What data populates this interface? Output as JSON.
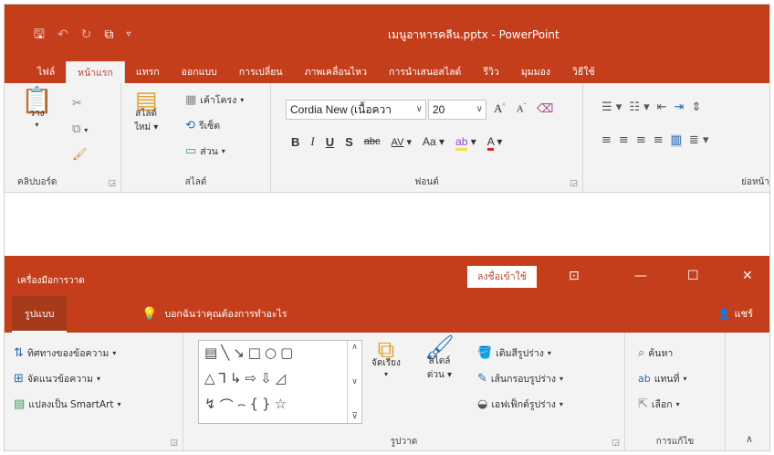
{
  "window1": {
    "qat": {
      "save_icon": "save-icon",
      "undo_icon": "undo-icon",
      "redo_icon": "redo-icon",
      "present_icon": "present-icon",
      "customize_icon": "chevron-down-icon"
    },
    "title": "เมนูอาหารคลีน.pptx  -  PowerPoint",
    "tabs": [
      "ไฟล์",
      "หน้าแรก",
      "แทรก",
      "ออกแบบ",
      "การเปลี่ยน",
      "ภาพเคลื่อนไหว",
      "การนำเสนอสไลด์",
      "รีวิว",
      "มุมมอง",
      "วิธีใช้"
    ],
    "active_tab": "หน้าแรก",
    "clipboard": {
      "paste": "วาง",
      "label": "คลิปบอร์ด"
    },
    "slides": {
      "new_slide": "สไลด์",
      "new_slide_2": "ใหม่",
      "layout": "เค้าโครง",
      "reset": "รีเซ็ต",
      "section": "ส่วน",
      "label": "สไลด์"
    },
    "font": {
      "name": "Cordia New (เนื้อควา",
      "size": "20",
      "bold": "B",
      "italic": "I",
      "underline": "U",
      "shadow": "S",
      "strike": "abc",
      "spacing": "AV",
      "case": "Aa",
      "label": "ฟอนต์"
    },
    "paragraph": {
      "label": "ย่อหน้า"
    }
  },
  "window2": {
    "app_title": "เครื่องมือการวาด",
    "signin": "ลงชื่อเข้าใช้",
    "active_tab": "รูปแบบ",
    "tell_me": "บอกฉันว่าคุณต้องการทำอะไร",
    "share": "แชร์",
    "text_group": {
      "direction": "ทิศทางของข้อความ",
      "align": "จัดแนวข้อความ",
      "smartart": "แปลงเป็น SmartArt"
    },
    "arrange": "จัดเรียง",
    "quick_styles": "สไตล์",
    "quick_styles_2": "ด่วน",
    "shape_fill": "เติมสีรูปร่าง",
    "shape_outline": "เส้นกรอบรูปร่าง",
    "shape_effects": "เอฟเฟ็กต์รูปร่าง",
    "shapes_label": "รูปวาด",
    "editing": {
      "find": "ค้นหา",
      "replace": "แทนที่",
      "select": "เลือก",
      "label": "การแก้ไข"
    }
  },
  "colors": {
    "accent": "#c43e1c",
    "ribbon_bg": "#f3f3f3",
    "tab_active_text": "#b7472a"
  }
}
